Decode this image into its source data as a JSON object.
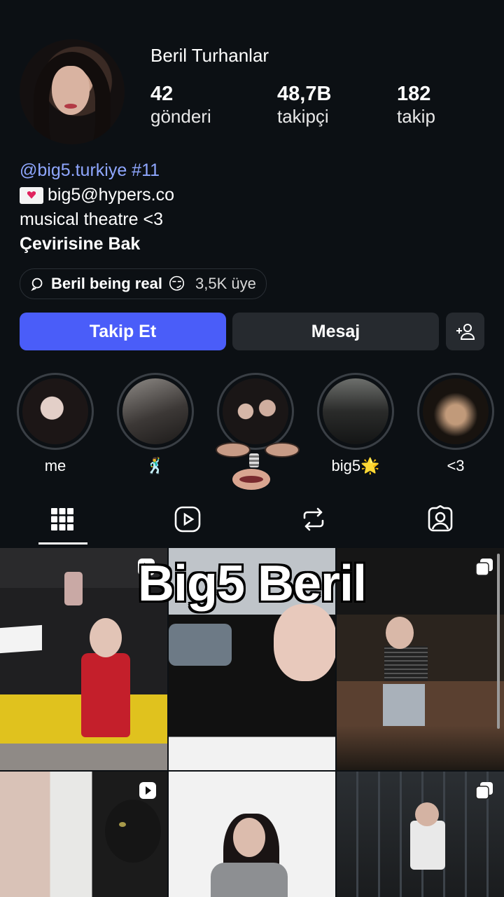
{
  "profile": {
    "name": "Beril Turhanlar",
    "stats": [
      {
        "value": "42",
        "label": "gönderi"
      },
      {
        "value": "48,7B",
        "label": "takipçi"
      },
      {
        "value": "182",
        "label": "takip"
      }
    ],
    "bio_link": "@big5.turkiye #11",
    "bio_email": "big5@hypers.co",
    "bio_desc": "musical theatre <3",
    "translate": "Çevirisine Bak"
  },
  "channel": {
    "name": "Beril being real",
    "emoji": "😏",
    "members": "3,5K üye"
  },
  "buttons": {
    "follow": "Takip Et",
    "message": "Mesaj"
  },
  "highlights": [
    {
      "label": "me"
    },
    {
      "label": "🕺"
    },
    {
      "label": ""
    },
    {
      "label": "big5🌟"
    },
    {
      "label": "<3"
    }
  ],
  "tabs": [
    "grid-icon",
    "reels-icon",
    "reposts-icon",
    "tagged-icon"
  ],
  "overlay_title": "Big5 Beril",
  "colors": {
    "accent": "#4a5df9",
    "link": "#8fa7ff",
    "background": "#0c1014"
  }
}
